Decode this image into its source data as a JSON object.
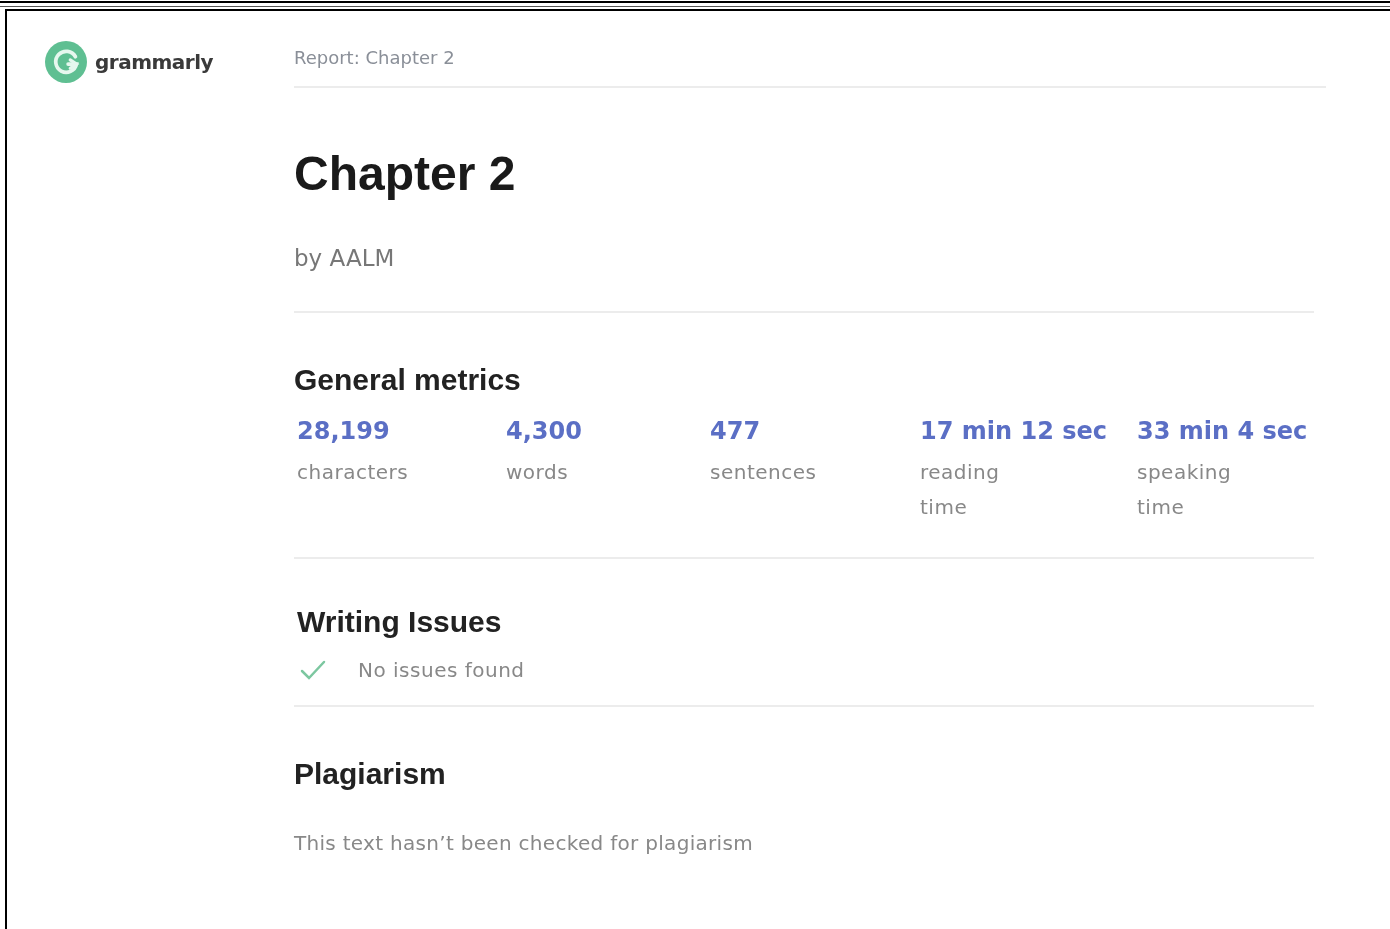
{
  "logo": {
    "text": "grammarly"
  },
  "breadcrumb": "Report: Chapter 2",
  "title": "Chapter 2",
  "author": "by AALM",
  "general_metrics": {
    "heading": "General metrics",
    "metrics": [
      {
        "value": "28,199",
        "label": "characters"
      },
      {
        "value": "4,300",
        "label": "words"
      },
      {
        "value": "477",
        "label": "sentences"
      },
      {
        "value": "17 min 12 sec",
        "label": "reading time"
      },
      {
        "value": "33 min 4 sec",
        "label": "speaking time"
      }
    ]
  },
  "writing_issues": {
    "heading": "Writing Issues",
    "status": "No issues found",
    "passed": true
  },
  "plagiarism": {
    "heading": "Plagiarism",
    "text": "This text hasn’t been checked for plagiarism"
  }
}
